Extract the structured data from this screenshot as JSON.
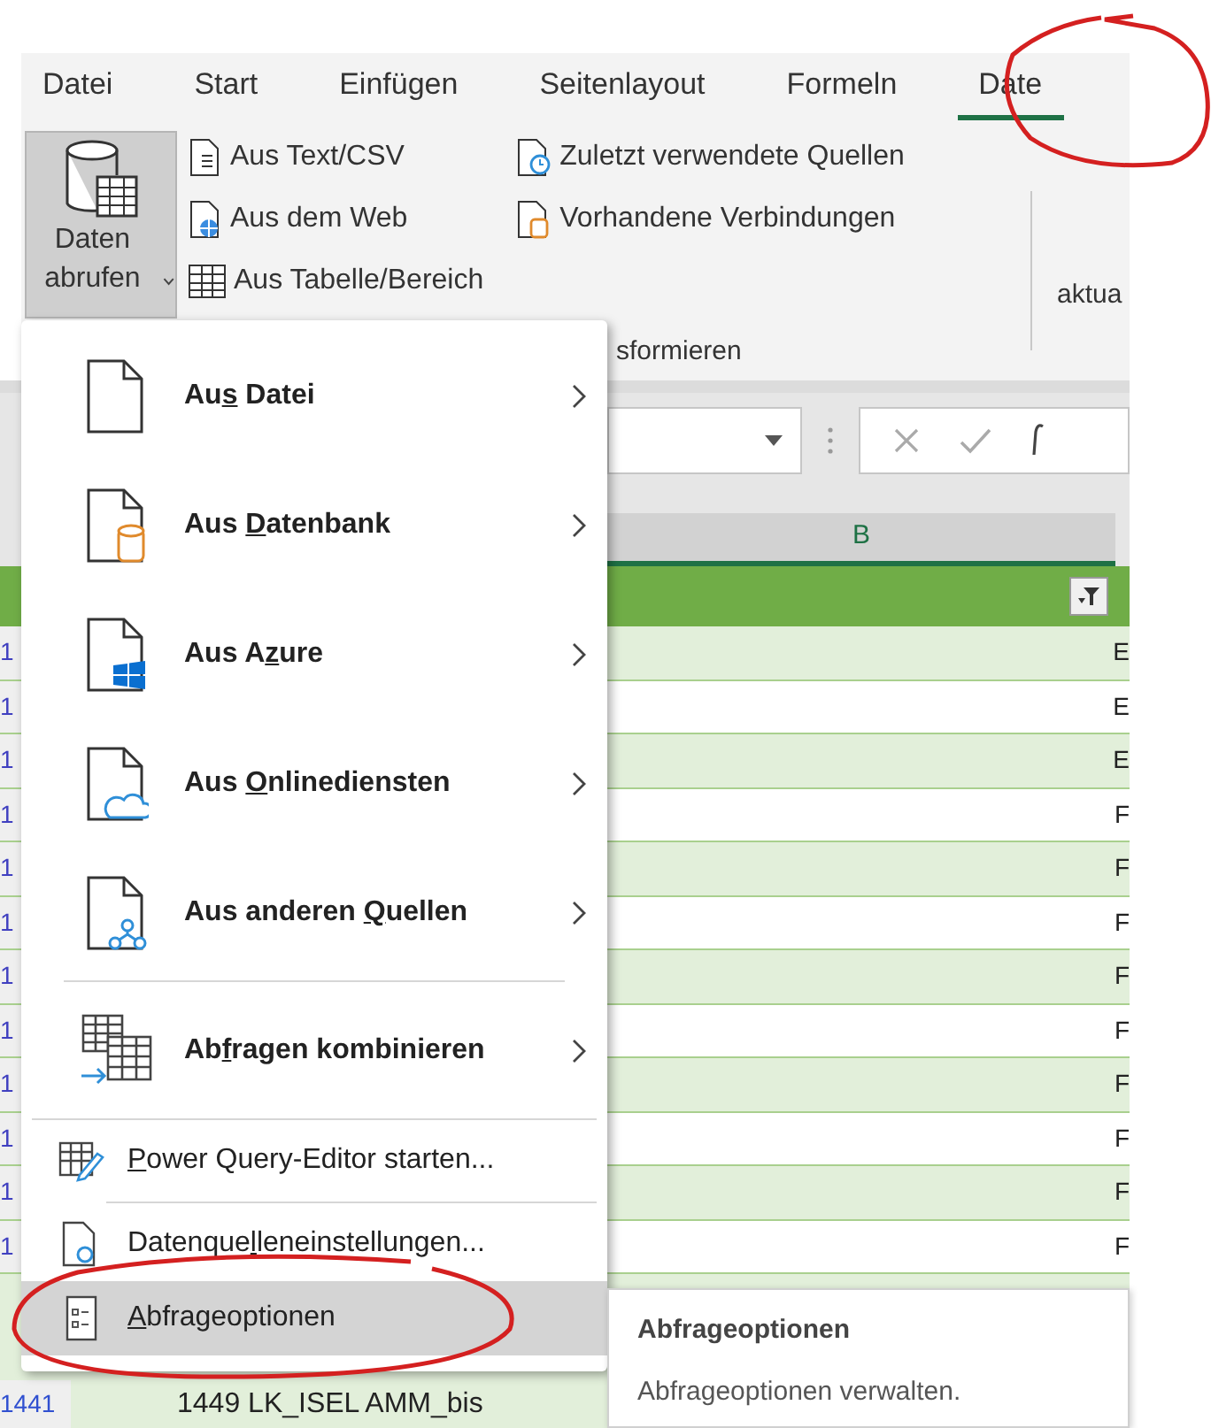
{
  "ribbon_tabs": [
    {
      "label": "Datei",
      "selected": false
    },
    {
      "label": "Start",
      "selected": false
    },
    {
      "label": "Einfügen",
      "selected": false
    },
    {
      "label": "Seitenlayout",
      "selected": false
    },
    {
      "label": "Formeln",
      "selected": false
    },
    {
      "label": "Date",
      "selected": true
    }
  ],
  "ribbon": {
    "get_data_button": {
      "label": "Daten abrufen",
      "pressed": true
    },
    "commands_left": [
      "Aus Text/CSV",
      "Aus dem Web",
      "Aus Tabelle/Bereich"
    ],
    "commands_right": [
      "Zuletzt verwendete Quellen",
      "Vorhandene Verbindungen"
    ],
    "group_label": "sformieren",
    "cut_command": "aktua"
  },
  "grid": {
    "column_header": "B",
    "rows": [
      {
        "row_number": "1",
        "column_3": "E",
        "shaded": true
      },
      {
        "row_number": "1",
        "column_3": "E",
        "shaded": false
      },
      {
        "row_number": "1",
        "column_3": "E",
        "shaded": true
      },
      {
        "row_number": "1",
        "column_3": "F",
        "shaded": false
      },
      {
        "row_number": "1",
        "column_3": "F",
        "shaded": true
      },
      {
        "row_number": "1",
        "column_3": "F",
        "shaded": false
      },
      {
        "row_number": "1",
        "column_3": "F",
        "shaded": true
      },
      {
        "row_number": "1",
        "column_3": "F",
        "shaded": false
      },
      {
        "row_number": "1",
        "column_3": "F",
        "shaded": true
      },
      {
        "row_number": "1",
        "column_3": "F",
        "shaded": false
      },
      {
        "row_number": "1",
        "column_3": "F",
        "shaded": true
      },
      {
        "row_number": "1",
        "column_3": "F",
        "shaded": false
      }
    ],
    "last_row": {
      "row_number": "1441",
      "cell": "1449 LK_ISEL AMM_bis"
    }
  },
  "menu": [
    {
      "kind": "large",
      "label": {
        "before": "Au",
        "key": "s",
        "after": " Datei"
      },
      "submenu": true,
      "separator_before": false,
      "selected": false
    },
    {
      "kind": "large",
      "label": {
        "before": "Aus ",
        "key": "D",
        "after": "atenbank"
      },
      "submenu": true,
      "separator_before": false,
      "selected": false
    },
    {
      "kind": "large",
      "label": {
        "before": "Aus A",
        "key": "z",
        "after": "ure"
      },
      "submenu": true,
      "separator_before": false,
      "selected": false
    },
    {
      "kind": "large",
      "label": {
        "before": "Aus ",
        "key": "O",
        "after": "nlinediensten"
      },
      "submenu": true,
      "separator_before": false,
      "selected": false
    },
    {
      "kind": "large",
      "label": {
        "before": "Aus anderen ",
        "key": "Q",
        "after": "uellen"
      },
      "submenu": true,
      "separator_before": false,
      "selected": false
    },
    {
      "kind": "large",
      "label": {
        "before": "Ab",
        "key": "f",
        "after": "ragen kombinieren"
      },
      "submenu": true,
      "separator_before": true,
      "selected": false
    },
    {
      "kind": "small",
      "label": {
        "key": "P",
        "after": "ower Query-Editor starten..."
      },
      "submenu": false,
      "separator_before": true,
      "selected": false
    },
    {
      "kind": "small",
      "label": {
        "before": "Datenque",
        "key": "l",
        "after": "leneinstellungen..."
      },
      "submenu": false,
      "separator_before": true,
      "selected": false
    },
    {
      "kind": "small",
      "label": {
        "key": "A",
        "after": "bfrageoptionen"
      },
      "submenu": false,
      "separator_before": false,
      "selected": true
    }
  ],
  "tooltip": {
    "title": "Abfrageoptionen",
    "description": "Abfrageoptionen verwalten."
  }
}
